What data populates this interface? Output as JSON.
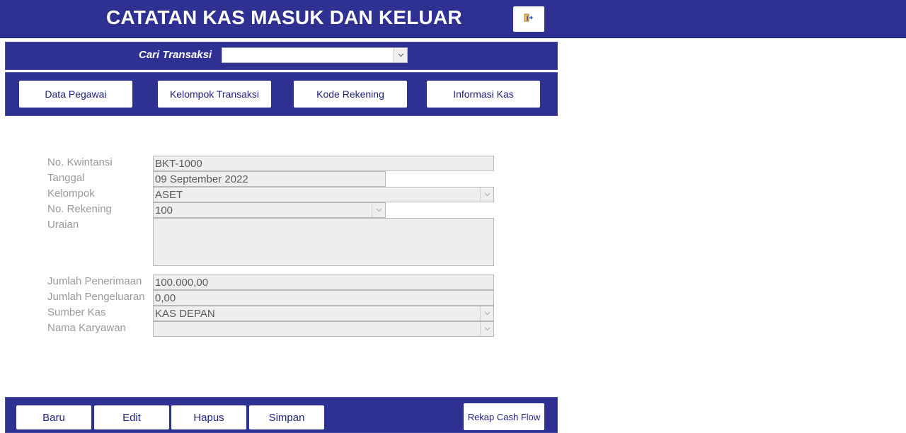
{
  "header": {
    "title": "CATATAN KAS MASUK DAN KELUAR",
    "exit_icon": "door-exit-icon"
  },
  "search": {
    "label": "Cari Transaksi",
    "value": ""
  },
  "nav": {
    "data_pegawai": "Data Pegawai",
    "kelompok_transaksi": "Kelompok Transaksi",
    "kode_rekening": "Kode Rekening",
    "informasi_kas": "Informasi Kas"
  },
  "form": {
    "no_kwintansi": {
      "label": "No. Kwintansi",
      "value": "BKT-1000"
    },
    "tanggal": {
      "label": "Tanggal",
      "value": "09 September 2022"
    },
    "kelompok": {
      "label": "Kelompok",
      "value": "ASET"
    },
    "no_rekening": {
      "label": "No. Rekening",
      "value": "100"
    },
    "uraian": {
      "label": "Uraian",
      "value": ""
    },
    "jumlah_penerimaan": {
      "label": "Jumlah Penerimaan",
      "value": "100.000,00"
    },
    "jumlah_pengeluaran": {
      "label": "Jumlah Pengeluaran",
      "value": "0,00"
    },
    "sumber_kas": {
      "label": "Sumber Kas",
      "value": "KAS DEPAN"
    },
    "nama_karyawan": {
      "label": "Nama Karyawan",
      "value": ""
    }
  },
  "actions": {
    "baru": "Baru",
    "edit": "Edit",
    "hapus": "Hapus",
    "simpan": "Simpan",
    "rekap": "Rekap Cash Flow"
  },
  "colors": {
    "primary": "#2e3192",
    "button_text": "#1f2380",
    "field_bg": "#eeeeee",
    "label": "#9a9a9a"
  }
}
